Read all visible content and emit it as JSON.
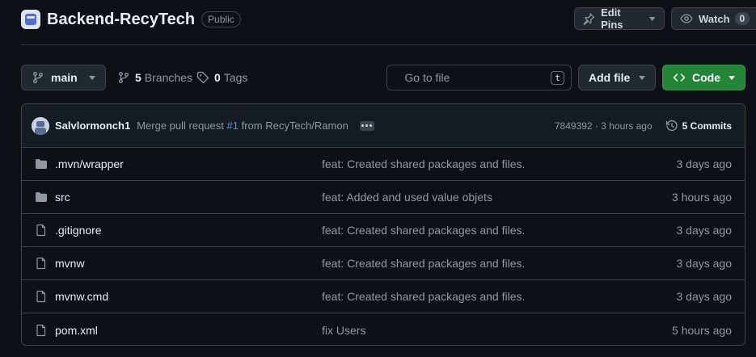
{
  "repo": {
    "name": "Backend-RecyTech",
    "visibility": "Public"
  },
  "header_buttons": {
    "edit_pins": "Edit Pins",
    "watch": "Watch",
    "watch_count": "0"
  },
  "toolbar": {
    "branch": "main",
    "branches_count": "5",
    "branches_label": "Branches",
    "tags_count": "0",
    "tags_label": "Tags",
    "search_placeholder": "Go to file",
    "search_shortcut": "t",
    "add_file": "Add file",
    "code": "Code"
  },
  "latest_commit": {
    "author": "Salvlormonch1",
    "message_prefix": "Merge pull request",
    "pr_link": "#1",
    "message_suffix": "from RecyTech/Ramon",
    "meta": "7849392 · 3 hours ago",
    "commits_label": "5 Commits"
  },
  "files": [
    {
      "type": "folder",
      "name": ".mvn/wrapper",
      "message": "feat: Created shared packages and files.",
      "date": "3 days ago"
    },
    {
      "type": "folder",
      "name": "src",
      "message": "feat: Added and used value objets",
      "date": "3 hours ago"
    },
    {
      "type": "file",
      "name": ".gitignore",
      "message": "feat: Created shared packages and files.",
      "date": "3 days ago"
    },
    {
      "type": "file",
      "name": "mvnw",
      "message": "feat: Created shared packages and files.",
      "date": "3 days ago"
    },
    {
      "type": "file",
      "name": "mvnw.cmd",
      "message": "feat: Created shared packages and files.",
      "date": "3 days ago"
    },
    {
      "type": "file",
      "name": "pom.xml",
      "message": "fix Users",
      "date": "5 hours ago"
    }
  ],
  "colors": {
    "accent_green": "#238636",
    "link_blue": "#4493f8",
    "background": "#0d1117"
  },
  "icons": {
    "folder": "folder-icon",
    "file": "file-icon"
  }
}
